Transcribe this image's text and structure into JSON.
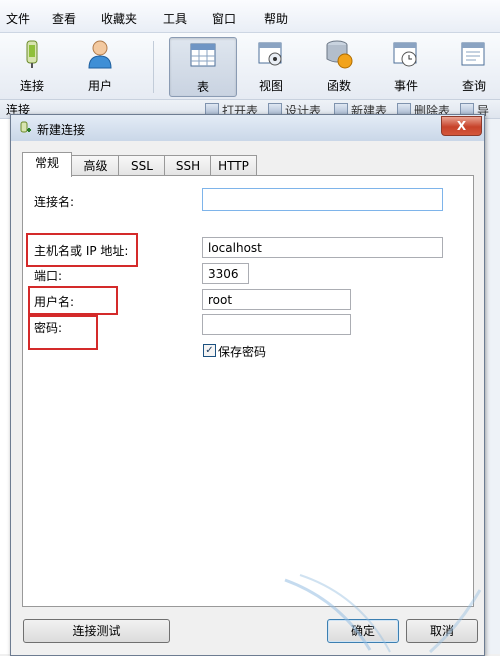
{
  "menubar": {
    "items": [
      "文件",
      "查看",
      "收藏夹",
      "工具",
      "窗口",
      "帮助"
    ]
  },
  "toolbar": {
    "buttons": [
      {
        "label": "连接",
        "icon": "connection-icon"
      },
      {
        "label": "用户",
        "icon": "user-icon"
      },
      {
        "label": "表",
        "icon": "table-icon",
        "active": true
      },
      {
        "label": "视图",
        "icon": "view-icon"
      },
      {
        "label": "函数",
        "icon": "function-icon"
      },
      {
        "label": "事件",
        "icon": "event-icon"
      },
      {
        "label": "查询",
        "icon": "query-icon"
      }
    ]
  },
  "subbar": {
    "left": "连接",
    "items": [
      "打开表",
      "设计表",
      "新建表",
      "删除表",
      "导入"
    ]
  },
  "dialog": {
    "title": "新建连接",
    "close_label": "X",
    "tabs": [
      "常规",
      "高级",
      "SSL",
      "SSH",
      "HTTP"
    ],
    "active_tab": "常规",
    "fields": {
      "connection_name_label": "连接名:",
      "connection_name_value": "",
      "host_label": "主机名或 IP 地址:",
      "host_value": "localhost",
      "port_label": "端口:",
      "port_value": "3306",
      "username_label": "用户名:",
      "username_value": "root",
      "password_label": "密码:",
      "password_value": ""
    },
    "save_password_label": "保存密码",
    "save_password_checked": true,
    "test_button": "连接测试",
    "ok_button": "确定",
    "cancel_button": "取消"
  },
  "colors": {
    "highlight_box": "#d42a2a",
    "active_tab_bg": "#ffffff",
    "close_button": "#c7432a"
  }
}
